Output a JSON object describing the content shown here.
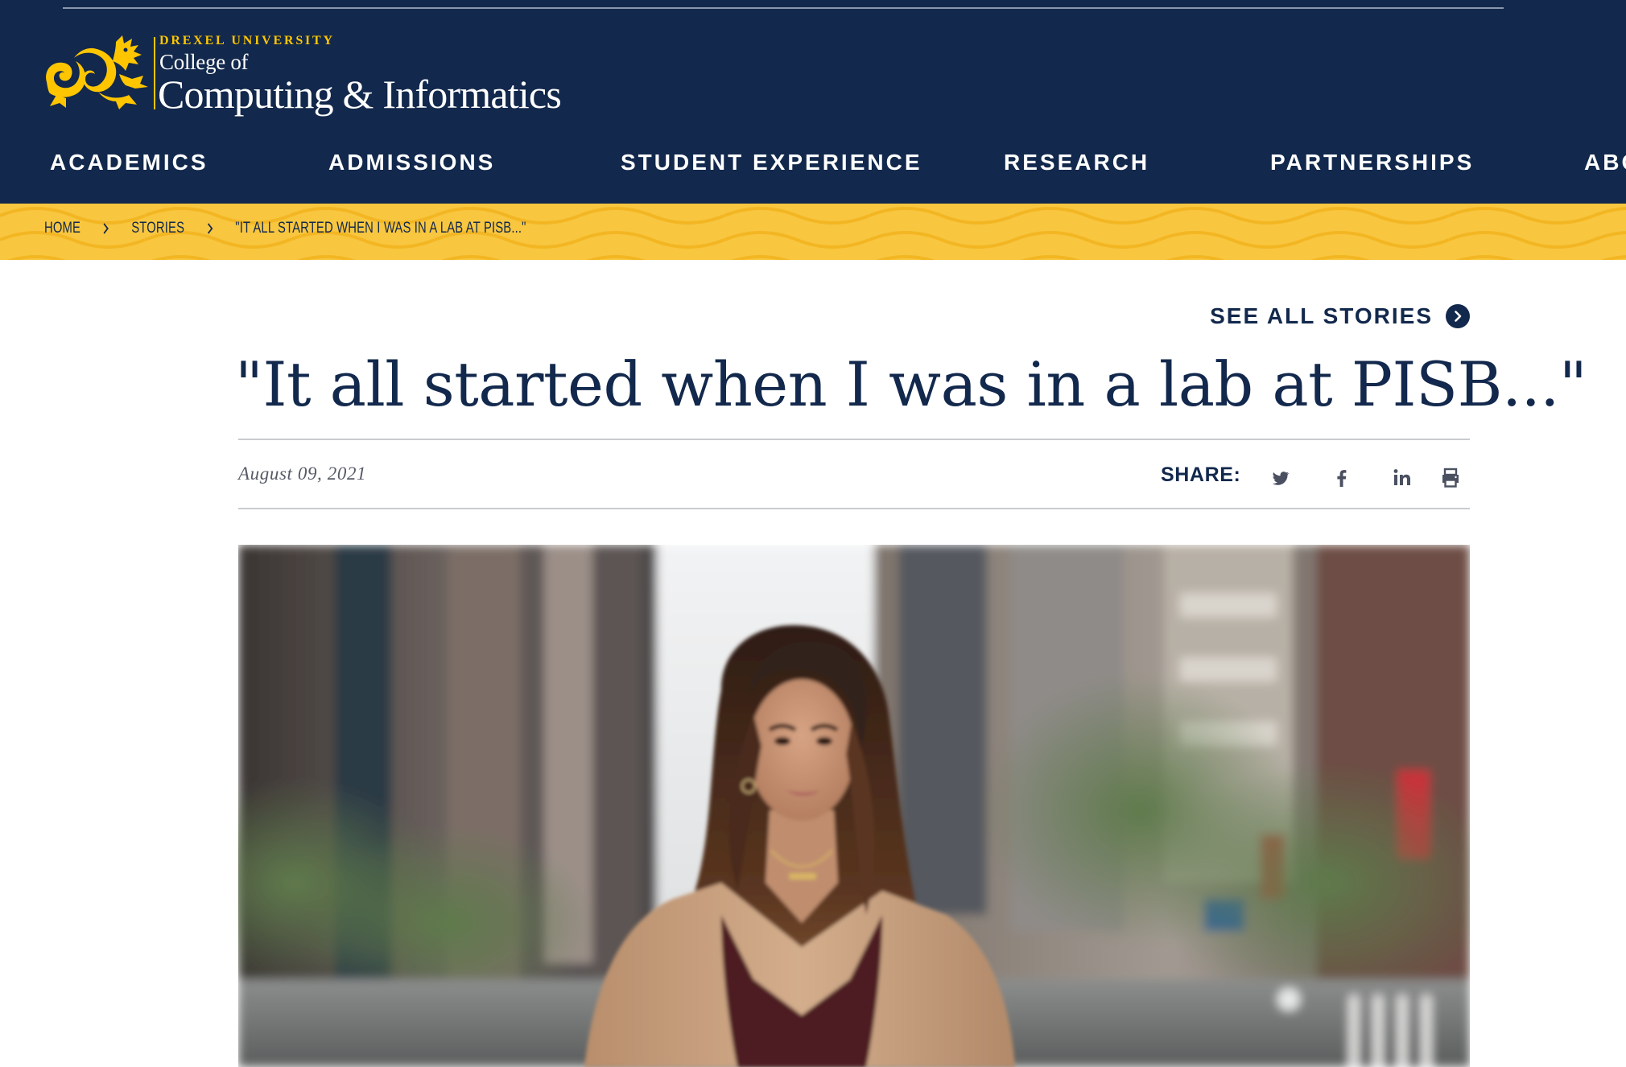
{
  "header": {
    "logo": {
      "university": "DREXEL UNIVERSITY",
      "college_line": "College of",
      "name_line": "Computing & Informatics",
      "icon": "drexel-dragon-icon",
      "accent_color": "#ffc600"
    },
    "background_color": "#12284c",
    "nav": [
      {
        "label": "ACADEMICS"
      },
      {
        "label": "ADMISSIONS"
      },
      {
        "label": "STUDENT EXPERIENCE"
      },
      {
        "label": "RESEARCH"
      },
      {
        "label": "PARTNERSHIPS"
      },
      {
        "label": "ABO"
      }
    ]
  },
  "breadcrumb": {
    "items": [
      "HOME",
      "STORIES",
      "\"IT ALL STARTED WHEN I WAS IN A LAB AT PISB...\""
    ],
    "separator_icon": "chevron-right-icon",
    "background_color": "#f8c63f"
  },
  "article": {
    "see_all_label": "SEE ALL STORIES",
    "see_all_icon": "circle-chevron-right-icon",
    "title": "\"It all started when I was in a lab at PISB...\"",
    "date": "August 09, 2021",
    "share_label": "SHARE:",
    "share_icons": [
      "twitter-icon",
      "facebook-icon",
      "linkedin-icon",
      "print-icon"
    ],
    "photo": "portrait-of-student-on-city-street"
  }
}
